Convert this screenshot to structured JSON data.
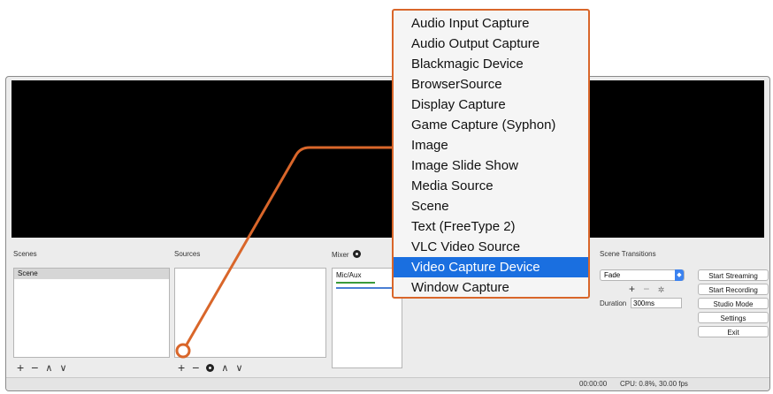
{
  "scenes": {
    "title": "Scenes",
    "items": [
      "Scene"
    ]
  },
  "sources": {
    "title": "Sources"
  },
  "mixer": {
    "title": "Mixer",
    "channel": "Mic/Aux"
  },
  "transitions": {
    "title": "Scene Transitions",
    "selected": "Fade",
    "duration_label": "Duration",
    "duration_value": "300ms"
  },
  "controls": {
    "start_streaming": "Start Streaming",
    "start_recording": "Start Recording",
    "studio_mode": "Studio Mode",
    "settings": "Settings",
    "exit": "Exit"
  },
  "status": {
    "time": "00:00:00",
    "cpu": "CPU: 0.8%, 30.00 fps"
  },
  "menu": {
    "items": [
      "Audio Input Capture",
      "Audio Output Capture",
      "Blackmagic Device",
      "BrowserSource",
      "Display Capture",
      "Game Capture (Syphon)",
      "Image",
      "Image Slide Show",
      "Media Source",
      "Scene",
      "Text (FreeType 2)",
      "VLC Video Source",
      "Video Capture Device",
      "Window Capture"
    ],
    "selected_index": 12
  },
  "colors": {
    "callout": "#d9662a",
    "selection": "#1a6fe0"
  }
}
